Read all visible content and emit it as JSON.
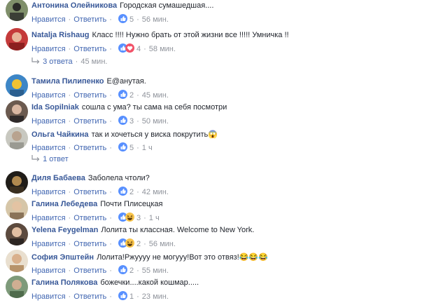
{
  "labels": {
    "like": "Нравится",
    "reply": "Ответить",
    "sep": "·"
  },
  "comments": [
    {
      "name": "Антонина Олейникова",
      "text": "Городская сумашедшая....",
      "count": "5",
      "time": "56 мин.",
      "react": "like"
    },
    {
      "name": "Natalja Rishaug",
      "text": "Класс !!!! Нужно брать от этой жизни все !!!!! Умничка !!",
      "count": "4",
      "time": "58 мин.",
      "react": "like-love"
    },
    {
      "name": "Тамила Пилипенко",
      "text": "Е@анутая.",
      "count": "2",
      "time": "45 мин.",
      "react": "like"
    },
    {
      "name": "Ida Sopilniak",
      "text": "сошла с ума? ты сама на себя посмотри",
      "count": "3",
      "time": "50 мин.",
      "react": "like"
    },
    {
      "name": "Ольга Чайкина",
      "text": "так и хочеться у виска покрутить😱",
      "count": "5",
      "time": "1 ч",
      "react": "like"
    },
    {
      "name": "Диля Бабаева",
      "text": "Заболела чтоли?",
      "count": "2",
      "time": "42 мин.",
      "react": "like"
    },
    {
      "name": "Галина Лебедева",
      "text": "Почти Плисецкая",
      "count": "3",
      "time": "1 ч",
      "react": "like-haha"
    },
    {
      "name": "Yelena Feygelman",
      "text": "Лолита ты классная. Welcome to New York.",
      "count": "2",
      "time": "56 мин.",
      "react": "like-haha"
    },
    {
      "name": "София Эпштейн",
      "text": "Лолита!Ржуууу не могууу!Вот это отвяз!😂😂😂",
      "count": "2",
      "time": "55 мин.",
      "react": "like"
    },
    {
      "name": "Галина Полякова",
      "text": "божечки....какой кошмар.....",
      "count": "1",
      "time": "23 мин.",
      "react": "like"
    }
  ],
  "reply_links": [
    {
      "label": "3 ответа",
      "time": "45 мин."
    },
    {
      "label": "1 ответ",
      "time": ""
    }
  ],
  "colors": {
    "name": "#385898",
    "link": "#4267b2",
    "meta": "#90949c",
    "like": "#5890ff",
    "love": "#f25268",
    "haha": "#f7c34a"
  }
}
